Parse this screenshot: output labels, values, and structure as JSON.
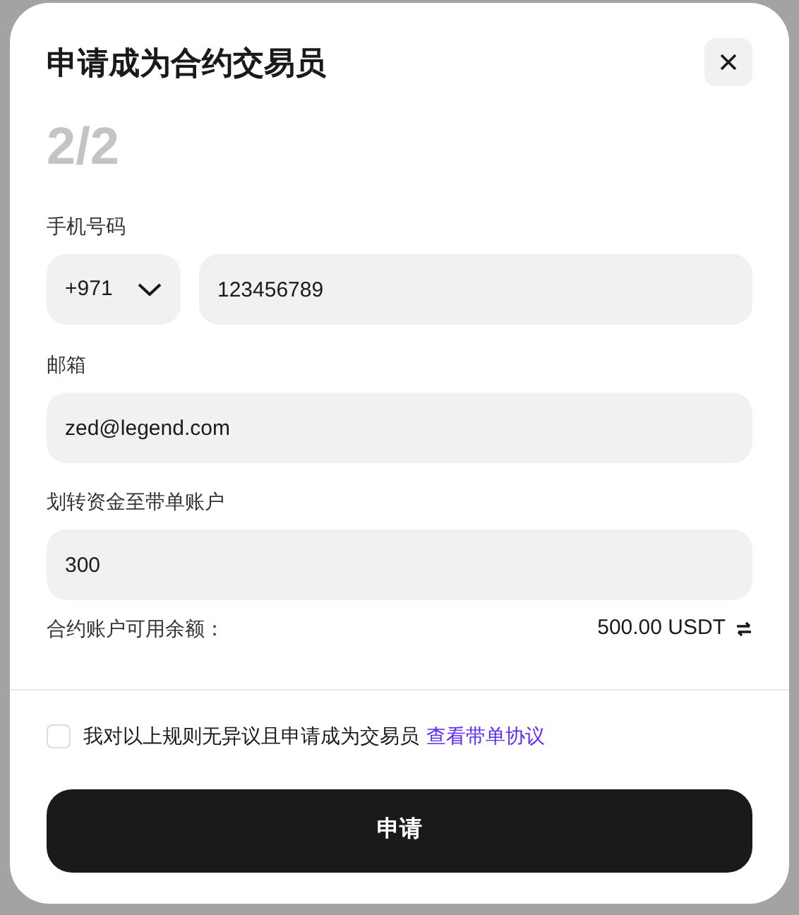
{
  "dialog": {
    "title": "申请成为合约交易员",
    "step": "2/2"
  },
  "phone": {
    "label": "手机号码",
    "country_code": "+971",
    "value": "123456789"
  },
  "email": {
    "label": "邮箱",
    "value": "zed@legend.com"
  },
  "transfer": {
    "label": "划转资金至带单账户",
    "value": "300"
  },
  "balance": {
    "label": "合约账户可用余额：",
    "value": "500.00 USDT"
  },
  "agreement": {
    "checked": false,
    "text": "我对以上规则无异议且申请成为交易员",
    "link": "查看带单协议"
  },
  "submit": {
    "label": "申请"
  }
}
